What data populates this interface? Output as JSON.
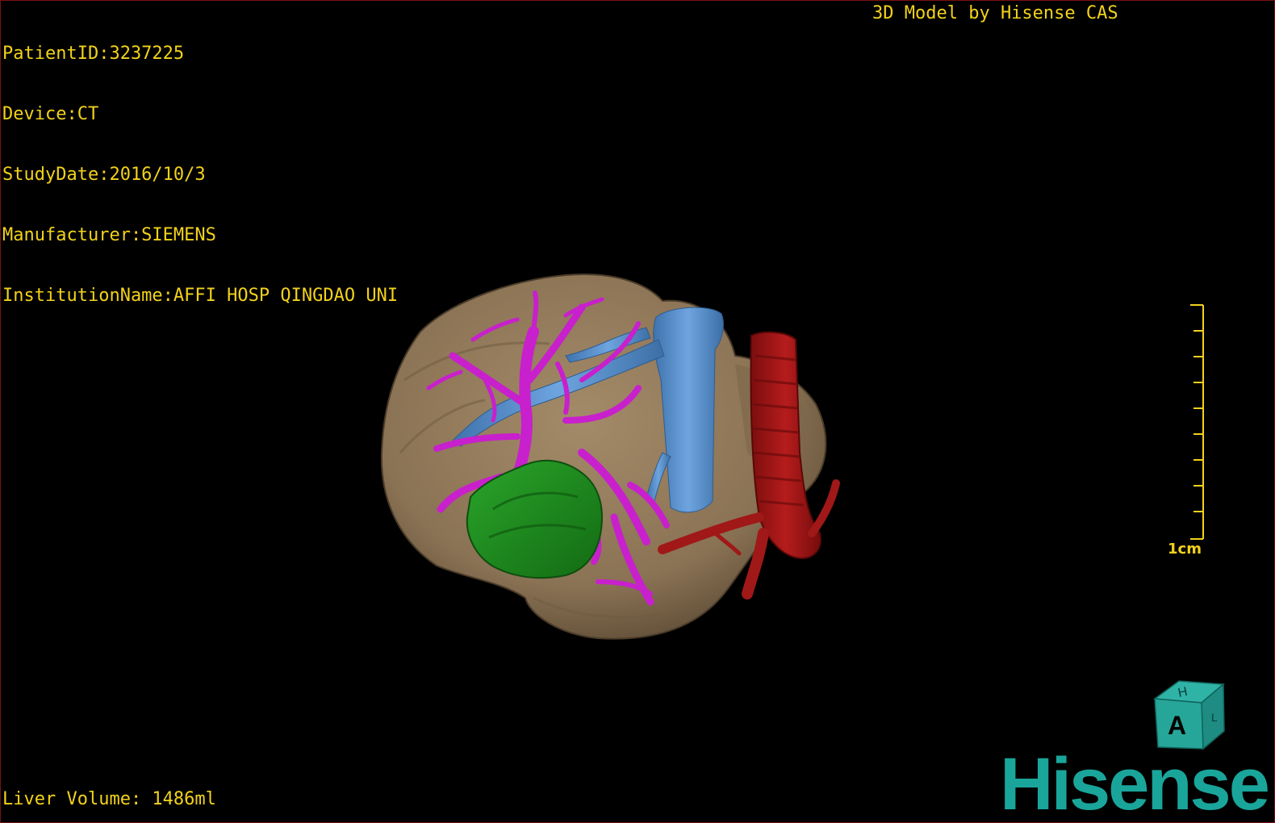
{
  "viewer": {
    "info_lines": [
      "PatientID:3237225",
      "Device:CT",
      "StudyDate:2016/10/3",
      "Manufacturer:SIEMENS",
      "InstitutionName:AFFI HOSP QINGDAO UNI"
    ],
    "credit": "3D Model by Hisense CAS",
    "liver_volume": "Liver Volume: 1486ml",
    "scale_label": "1cm",
    "orientation_cube": {
      "front": "A",
      "top": "H",
      "side": "L"
    },
    "brand": "Hisense"
  },
  "colors": {
    "overlay_text": "#f2d21b",
    "liver": "#8c7557",
    "portal_vein": "#c21fc7",
    "hepatic_vein": "#4f87c5",
    "tumor": "#1f8a1f",
    "artery": "#9b1414",
    "brand": "#1aa59b"
  },
  "icons": [
    "orientation-cube-icon",
    "hisense-logo"
  ]
}
